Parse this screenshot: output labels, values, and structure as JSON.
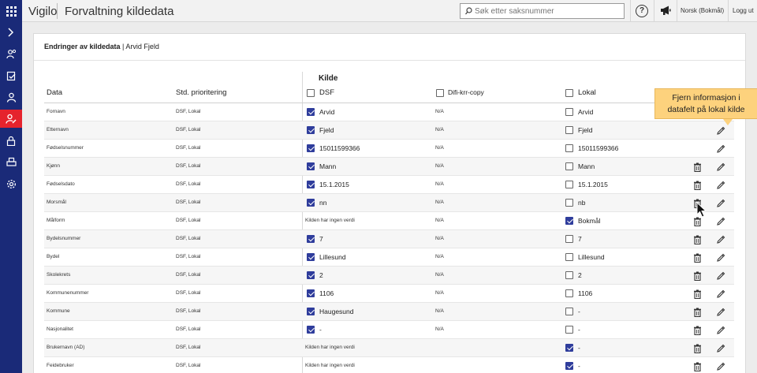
{
  "app": {
    "brand": "Vigilo",
    "title": "Forvaltning kildedata"
  },
  "topbar": {
    "search_placeholder": "Søk etter saksnummer",
    "help_label": "?",
    "language": "Norsk (Bokmål)",
    "logout": "Logg ut"
  },
  "sidebar": {
    "items": [
      {
        "icon": "chevron-right-icon"
      },
      {
        "icon": "person-search-icon"
      },
      {
        "icon": "report-icon"
      },
      {
        "icon": "person-icon"
      },
      {
        "icon": "person-edit-icon",
        "active": true
      },
      {
        "icon": "lock-icon"
      },
      {
        "icon": "printer-icon"
      },
      {
        "icon": "gear-icon"
      }
    ]
  },
  "panel": {
    "title_bold": "Endringer av kildedata",
    "title_rest": " | Arvid Fjeld"
  },
  "table": {
    "group_label": "Kilde",
    "headers": {
      "data": "Data",
      "priority": "Std. prioritering",
      "dsf": "DSF",
      "difi": "Difi-krr-copy",
      "lokal": "Lokal"
    },
    "rows": [
      {
        "field": "Fornavn",
        "priority": "DSF, Lokal",
        "dsf": "Arvid",
        "dsf_checked": true,
        "difi": "N/A",
        "lokal": "Arvid",
        "lokal_checked": false,
        "lokal_cbx": true,
        "trash": false
      },
      {
        "field": "Etternavn",
        "priority": "DSF, Lokal",
        "dsf": "Fjeld",
        "dsf_checked": true,
        "difi": "N/A",
        "lokal": "Fjeld",
        "lokal_checked": false,
        "lokal_cbx": true,
        "trash": false
      },
      {
        "field": "Fødselsnummer",
        "priority": "DSF, Lokal",
        "dsf": "15011599366",
        "dsf_checked": true,
        "difi": "N/A",
        "lokal": "15011599366",
        "lokal_checked": false,
        "lokal_cbx": true,
        "trash": false
      },
      {
        "field": "Kjønn",
        "priority": "DSF, Lokal",
        "dsf": "Mann",
        "dsf_checked": true,
        "difi": "N/A",
        "lokal": "Mann",
        "lokal_checked": false,
        "lokal_cbx": true,
        "trash": true
      },
      {
        "field": "Fødselsdato",
        "priority": "DSF, Lokal",
        "dsf": "15.1.2015",
        "dsf_checked": true,
        "difi": "N/A",
        "lokal": "15.1.2015",
        "lokal_checked": false,
        "lokal_cbx": true,
        "trash": true
      },
      {
        "field": "Morsmål",
        "priority": "DSF, Lokal",
        "dsf": "nn",
        "dsf_checked": true,
        "difi": "N/A",
        "lokal": "nb",
        "lokal_checked": false,
        "lokal_cbx": true,
        "trash": true
      },
      {
        "field": "Målform",
        "priority": "DSF, Lokal",
        "dsf": "Kilden har ingen verdi",
        "dsf_checked": null,
        "difi": "N/A",
        "lokal": "Bokmål",
        "lokal_checked": true,
        "lokal_cbx": true,
        "trash": true
      },
      {
        "field": "Bydelsnummer",
        "priority": "DSF, Lokal",
        "dsf": "7",
        "dsf_checked": true,
        "difi": "N/A",
        "lokal": "7",
        "lokal_checked": false,
        "lokal_cbx": true,
        "trash": true
      },
      {
        "field": "Bydel",
        "priority": "DSF, Lokal",
        "dsf": "Lillesund",
        "dsf_checked": true,
        "difi": "N/A",
        "lokal": "Lillesund",
        "lokal_checked": false,
        "lokal_cbx": true,
        "trash": true
      },
      {
        "field": "Skolekrets",
        "priority": "DSF, Lokal",
        "dsf": "2",
        "dsf_checked": true,
        "difi": "N/A",
        "lokal": "2",
        "lokal_checked": false,
        "lokal_cbx": true,
        "trash": true
      },
      {
        "field": "Kommunenummer",
        "priority": "DSF, Lokal",
        "dsf": "1106",
        "dsf_checked": true,
        "difi": "N/A",
        "lokal": "1106",
        "lokal_checked": false,
        "lokal_cbx": true,
        "trash": true
      },
      {
        "field": "Kommune",
        "priority": "DSF, Lokal",
        "dsf": "Haugesund",
        "dsf_checked": true,
        "difi": "N/A",
        "lokal": "-",
        "lokal_checked": false,
        "lokal_cbx": true,
        "trash": true
      },
      {
        "field": "Nasjonalitet",
        "priority": "DSF, Lokal",
        "dsf": "-",
        "dsf_checked": true,
        "difi": "N/A",
        "lokal": "-",
        "lokal_checked": false,
        "lokal_cbx": true,
        "trash": true
      },
      {
        "field": "Brukernavn (AD)",
        "priority": "DSF, Lokal",
        "dsf": "Kilden har ingen verdi",
        "dsf_checked": null,
        "difi": "",
        "lokal": "-",
        "lokal_checked": true,
        "lokal_cbx": true,
        "trash": true
      },
      {
        "field": "Feidebruker",
        "priority": "DSF, Lokal",
        "dsf": "Kilden har ingen verdi",
        "dsf_checked": null,
        "difi": "",
        "lokal": "-",
        "lokal_checked": true,
        "lokal_cbx": true,
        "trash": true
      }
    ]
  },
  "tooltip": {
    "text_line1": "Fjern informasjon i",
    "text_line2": "datafelt på lokal kilde"
  },
  "colors": {
    "sidebar": "#1a2a78",
    "active": "#e5232d",
    "checkbox": "#2f3d9c",
    "tooltip": "#fdd27d"
  }
}
